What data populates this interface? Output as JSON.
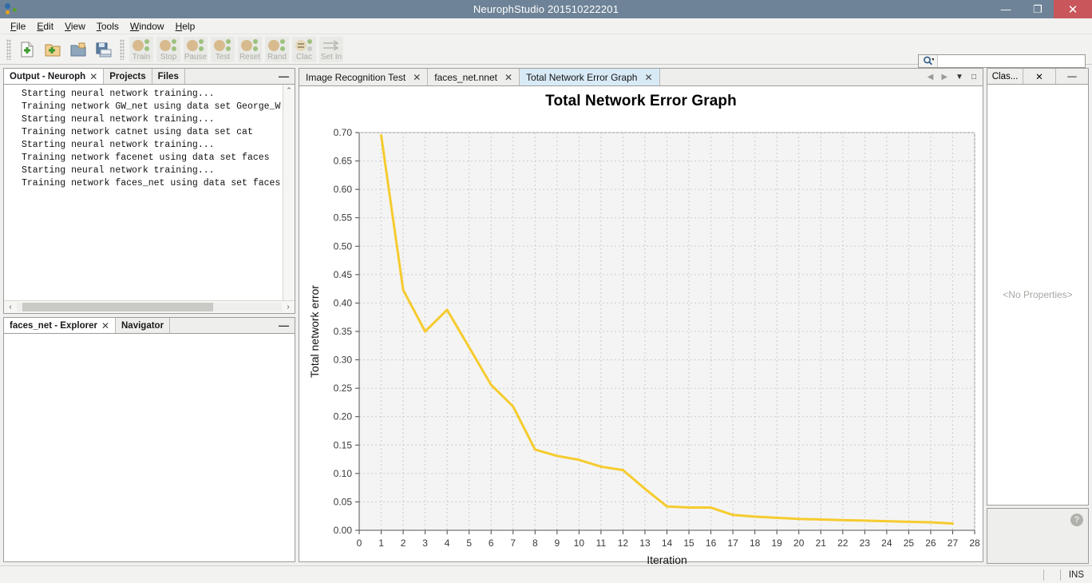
{
  "window": {
    "title": "NeurophStudio 201510222201",
    "minimize_label": "—",
    "maximize_label": "❐",
    "close_label": "✕"
  },
  "menubar": {
    "items": [
      {
        "mnemonic": "F",
        "rest": "ile"
      },
      {
        "mnemonic": "E",
        "rest": "dit"
      },
      {
        "mnemonic": "V",
        "rest": "iew"
      },
      {
        "mnemonic": "T",
        "rest": "ools"
      },
      {
        "mnemonic": "W",
        "rest": "indow"
      },
      {
        "mnemonic": "H",
        "rest": "elp"
      }
    ]
  },
  "toolbar": {
    "icon_buttons": [
      {
        "name": "new-file-icon",
        "tip": "New File"
      },
      {
        "name": "new-project-icon",
        "tip": "New Project"
      },
      {
        "name": "open-project-icon",
        "tip": "Open Project"
      },
      {
        "name": "save-all-icon",
        "tip": "Save All"
      }
    ],
    "training_buttons": [
      {
        "label": "Train",
        "name": "train-button"
      },
      {
        "label": "Stop",
        "name": "stop-button"
      },
      {
        "label": "Pause",
        "name": "pause-button"
      },
      {
        "label": "Test",
        "name": "test-button"
      },
      {
        "label": "Reset",
        "name": "reset-button"
      },
      {
        "label": "Rand",
        "name": "randomize-button"
      },
      {
        "label": "Clac",
        "name": "calculate-button"
      },
      {
        "label": "Set In",
        "name": "set-input-button"
      }
    ]
  },
  "search": {
    "placeholder": "",
    "value": "",
    "icon": "search-icon"
  },
  "output_panel": {
    "tabs": [
      {
        "label": "Output - Neuroph",
        "closable": true,
        "active": true
      },
      {
        "label": "Projects",
        "closable": false,
        "active": false
      },
      {
        "label": "Files",
        "closable": false,
        "active": false
      }
    ],
    "minimize_label": "—",
    "lines": [
      "Starting neural network training...",
      "Training network GW_net using data set George_W",
      "Starting neural network training...",
      "Training network catnet using data set cat",
      "Starting neural network training...",
      "Training network facenet using data set faces",
      "Starting neural network training...",
      "Training network faces_net using data set faces"
    ],
    "scroll_up": "⌃",
    "scroll_left": "‹",
    "scroll_right": "›"
  },
  "explorer_panel": {
    "tabs": [
      {
        "label": "faces_net - Explorer",
        "closable": true,
        "active": true
      },
      {
        "label": "Navigator",
        "closable": false,
        "active": false
      }
    ],
    "minimize_label": "—"
  },
  "editor": {
    "tabs": [
      {
        "label": "Image Recognition Test",
        "active": false
      },
      {
        "label": "faces_net.nnet",
        "active": false
      },
      {
        "label": "Total Network Error Graph",
        "active": true
      }
    ],
    "close_label": "✕",
    "nav_prev": "◀",
    "nav_next": "▶",
    "nav_list": "▼",
    "nav_maximize": "□"
  },
  "properties_panel": {
    "tab_label": "Clas...",
    "close_label": "✕",
    "minimize_label": "—",
    "empty_text": "<No Properties>",
    "help_icon_label": "?"
  },
  "statusbar": {
    "insert_mode": "INS"
  },
  "colors": {
    "titlebar": "#6e8397",
    "close_button": "#c8565a",
    "series_yellow": "#f6cb2e",
    "plot_background": "#f4f4f4",
    "active_tab": "#d9eaf7"
  },
  "chart_data": {
    "type": "line",
    "title": "Total Network Error Graph",
    "xlabel": "Iteration",
    "ylabel": "Total network error",
    "xlim": [
      0,
      28
    ],
    "ylim": [
      0.0,
      0.7
    ],
    "xticks": [
      0,
      1,
      2,
      3,
      4,
      5,
      6,
      7,
      8,
      9,
      10,
      11,
      12,
      13,
      14,
      15,
      16,
      17,
      18,
      19,
      20,
      21,
      22,
      23,
      24,
      25,
      26,
      27,
      28
    ],
    "yticks": [
      0.0,
      0.05,
      0.1,
      0.15,
      0.2,
      0.25,
      0.3,
      0.35,
      0.4,
      0.45,
      0.5,
      0.55,
      0.6,
      0.65,
      0.7
    ],
    "grid": true,
    "legend": false,
    "series": [
      {
        "name": "Total network error",
        "color": "#f6cb2e",
        "x": [
          1,
          2,
          3,
          4,
          5,
          6,
          7,
          8,
          9,
          10,
          11,
          12,
          13,
          14,
          15,
          16,
          17,
          18,
          19,
          20,
          21,
          22,
          23,
          24,
          25,
          26,
          27
        ],
        "values": [
          0.695,
          0.423,
          0.35,
          0.388,
          0.322,
          0.256,
          0.218,
          0.142,
          0.131,
          0.124,
          0.112,
          0.106,
          0.073,
          0.042,
          0.04,
          0.04,
          0.027,
          0.024,
          0.022,
          0.02,
          0.019,
          0.018,
          0.017,
          0.016,
          0.015,
          0.014,
          0.012
        ]
      }
    ]
  }
}
